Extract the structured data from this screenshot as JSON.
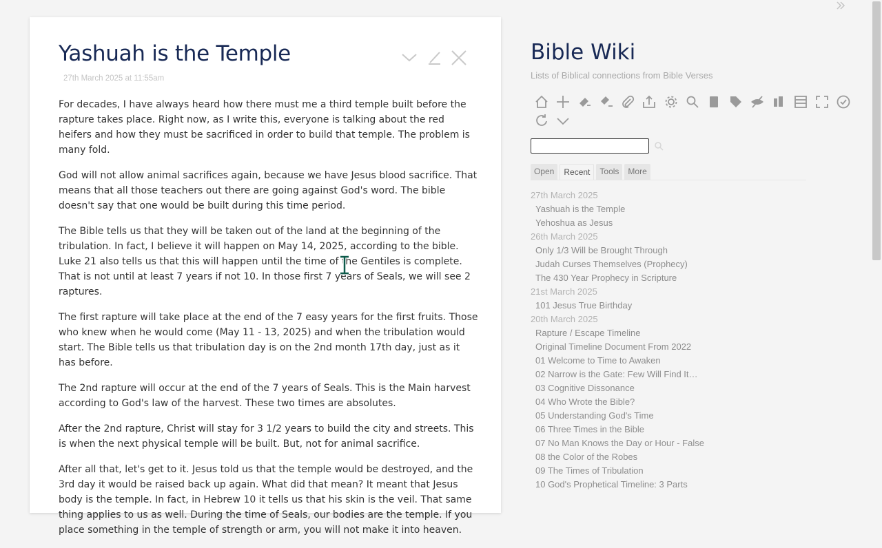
{
  "tiddler": {
    "title": "Yashuah is the Temple",
    "subtitle": "27th March 2025 at 11:55am",
    "paragraphs": [
      "For decades, I have always heard how there must me a third temple built before the rapture takes place. Right now, as I write this, everyone is talking about the red heifers and how they must be sacrificed in order to build that temple. The problem is many fold.",
      "God will not allow animal sacrifices again, because we have Jesus blood sacrifice. That means that all those teachers out there are going against God's word. The bible doesn't say that one would be built during this time period.",
      "The Bible tells us that they will be taken out of the land at the beginning of the tribulation. In fact, I believe it will happen on May 14, 2025, according to the bible. Luke 21 also tells us that this will happen until the time of the Gentiles is complete. That is not until at least 7 years if not 10. In those first 7 years of Seals, we will see 2 raptures.",
      "The first rapture will take place at the end of the 7 easy years for the first fruits. Those who knew when he would come (May 11 - 13, 2025) and when the tribulation would start. The Bible tells us that tribulation day is on the 2nd month 17th day, just as it has before.",
      "The 2nd rapture will occur at the end of the 7 years of Seals. This is the Main harvest according to God's law of the harvest. These two times are absolutes.",
      "After the 2nd rapture, Christ will stay for 3 1/2 years to build the city and streets. This is when the next physical temple will be built. But, not for animal sacrifice.",
      "After all that, let's get to it. Jesus told us that the temple would be destroyed, and the 3rd day it would be raised back up again. What did that mean? It meant that Jesus body is the temple. In fact, in Hebrew 10 it tells us that his skin is the veil. That same thing applies to us as well. During the time of Seals, our bodies are the temple. If you place something in the temple of strength or arm, you will not make it into heaven."
    ],
    "controls": [
      "chevron-down-icon",
      "edit-icon",
      "close-icon"
    ]
  },
  "sidebar": {
    "title": "Bible Wiki",
    "subtitle": "Lists of Biblical connections from Bible Verses",
    "search": {
      "value": ""
    },
    "tabs": [
      "Open",
      "Recent",
      "Tools",
      "More"
    ],
    "active_tab": "Recent",
    "recent": [
      {
        "date": "27th March 2025",
        "items": [
          "Yashuah is the Temple",
          "Yehoshua as Jesus"
        ]
      },
      {
        "date": "26th March 2025",
        "items": [
          "Only 1/3 Will be Brought Through",
          "Judah Curses Themselves (Prophecy)",
          "The 430 Year Prophecy in Scripture"
        ]
      },
      {
        "date": "21st March 2025",
        "items": [
          "101 Jesus True Birthday"
        ]
      },
      {
        "date": "20th March 2025",
        "items": [
          "Rapture / Escape Timeline",
          "Original Timeline Document From 2022",
          "01 Welcome to Time to Awaken",
          "02 Narrow is the Gate: Few Will Find It…",
          "03 Cognitive Dissonance",
          "04 Who Wrote the Bible?",
          "05 Understanding God's Time",
          "06 Three Times in the Bible",
          "07 No Man Knows the Day or Hour - False",
          "08 the Color of the Robes",
          "09 The Times of Tribulation",
          "10 God's Prophetical Timeline: 3 Parts"
        ]
      }
    ]
  },
  "colors": {
    "title": "#182955",
    "icon": "#9a9a9a",
    "link": "#8d8d8d",
    "date": "#b2b2b2"
  }
}
